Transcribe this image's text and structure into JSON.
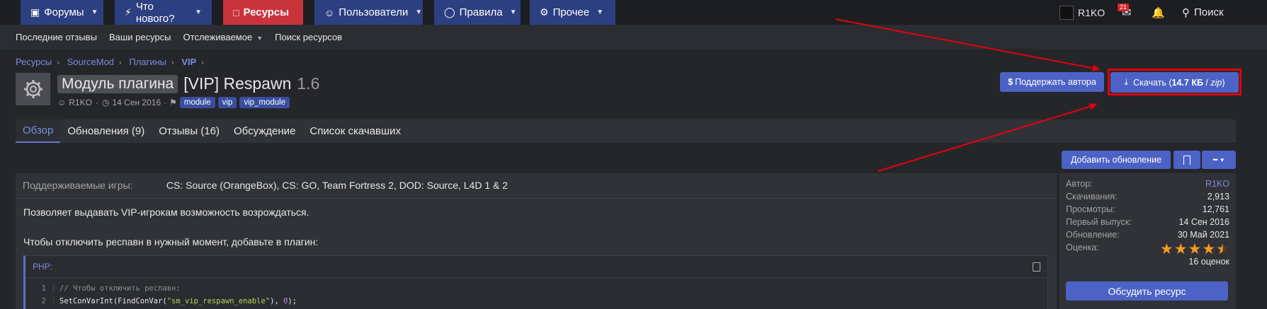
{
  "nav": {
    "forums": "Форумы",
    "whats_new": "Что нового?",
    "resources": "Ресурсы",
    "members": "Пользователи",
    "rules": "Правила",
    "other": "Прочее",
    "username": "R1KO",
    "inbox_count": "21",
    "search": "Поиск"
  },
  "subnav": {
    "latest_reviews": "Последние отзывы",
    "your_resources": "Ваши ресурсы",
    "watched": "Отслеживаемое",
    "search_resources": "Поиск ресурсов"
  },
  "breadcrumb": [
    "Ресурсы",
    "SourceMod",
    "Плагины",
    "VIP"
  ],
  "resource": {
    "prefix": "Модуль плагина",
    "title": "[VIP] Respawn",
    "version": "1.6",
    "author": "R1KO",
    "date": "14 Сен 2016",
    "tags": [
      "module",
      "vip",
      "vip_module"
    ]
  },
  "buttons": {
    "support": "Поддержать автора",
    "download_label": "Скачать (",
    "download_size": "14.7 КБ",
    "download_sep": " / ",
    "download_ext": "zip",
    "download_close": ")",
    "add_update": "Добавить обновление",
    "more": "•••",
    "discuss": "Обсудить ресурс"
  },
  "tabs": [
    "Обзор",
    "Обновления (9)",
    "Отзывы (16)",
    "Обсуждение",
    "Список скачавших"
  ],
  "content": {
    "games_label": "Поддерживаемые игры:",
    "games_value": "CS: Source (OrangeBox), CS: GO, Team Fortress 2, DOD: Source, L4D 1 & 2",
    "desc1": "Позволяет выдавать VIP-игрокам возможность возрождаться.",
    "desc2": "Чтобы отключить респавн в нужный момент, добавьте в плагин:",
    "code_lang": "PHP:",
    "code": [
      {
        "n": "1",
        "text": "// Чтобы отключить респавн:"
      },
      {
        "n": "2",
        "fn": "SetConVarInt(FindConVar(",
        "str": "\"sm_vip_respawn_enable\"",
        "rest": "), ",
        "num": "0",
        "end": ");"
      }
    ]
  },
  "stats": [
    {
      "k": "Автор:",
      "v": "R1KO"
    },
    {
      "k": "Скачивания:",
      "v": "2,913"
    },
    {
      "k": "Просмотры:",
      "v": "12,761"
    },
    {
      "k": "Первый выпуск:",
      "v": "14 Сен 2016"
    },
    {
      "k": "Обновление:",
      "v": "30 Май 2021"
    },
    {
      "k": "Оценка:",
      "v": ""
    }
  ],
  "rating": {
    "value": 4.5,
    "max": 5,
    "count_text": "16 оценок"
  },
  "colors": {
    "accent": "#4c62c4",
    "resources_tab": "#c9343c",
    "annotation": "#e5000b",
    "star": "#f39c1c"
  }
}
